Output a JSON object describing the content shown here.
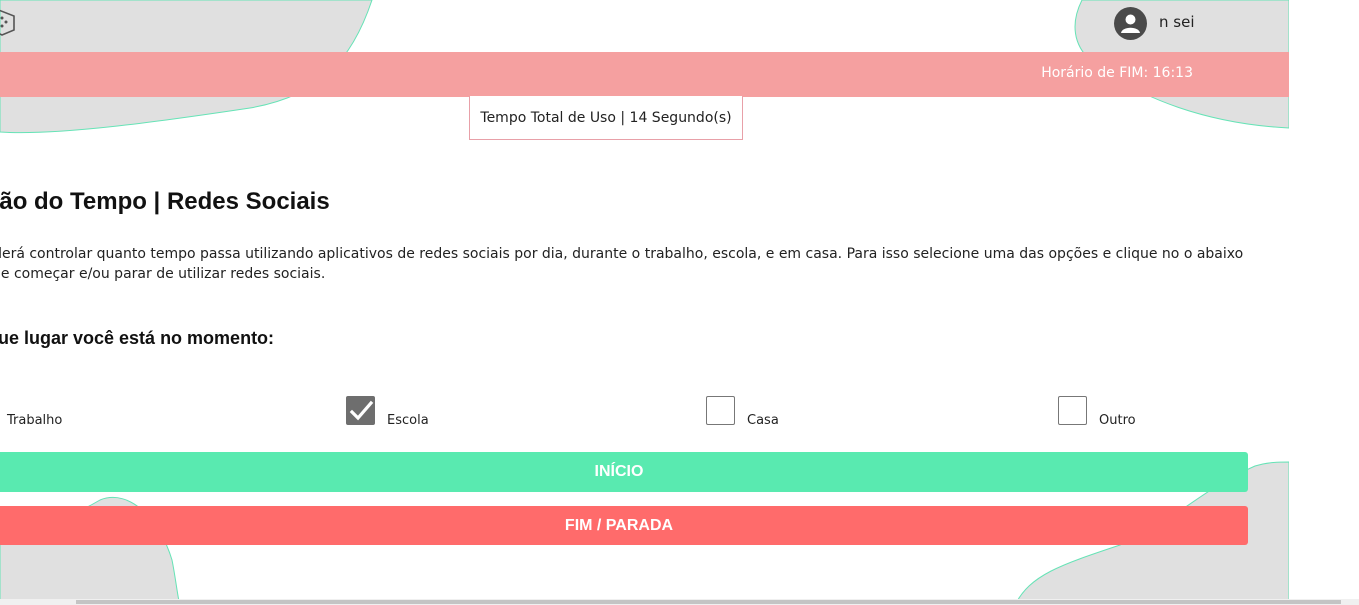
{
  "user": {
    "name": "n sei",
    "avatar_icon": "user-avatar-icon"
  },
  "banner": {
    "end_time_text": "Horário de FIM: 16:13",
    "color": "#f5a0a0"
  },
  "usage": {
    "total_text": "Tempo Total de Uso | 14 Segundo(s)"
  },
  "main": {
    "title": "stão do Tempo | Redes Sociais",
    "description": "você poderá controlar quanto tempo passa utilizando aplicativos de redes sociais por dia, durante o trabalho, escola, e em casa. Para isso selecione uma das opções e clique no o abaixo assim que começar e/ou parar de utilizar redes sociais.",
    "question": "que lugar você está no momento:"
  },
  "options": [
    {
      "label": "Trabalho",
      "checked": false
    },
    {
      "label": "Escola",
      "checked": true
    },
    {
      "label": "Casa",
      "checked": false
    },
    {
      "label": "Outro",
      "checked": false
    }
  ],
  "buttons": {
    "start_label": "INÍCIO",
    "start_color": "#59eab0",
    "stop_label": "FIM / PARADA",
    "stop_color": "#ff6b6b"
  }
}
